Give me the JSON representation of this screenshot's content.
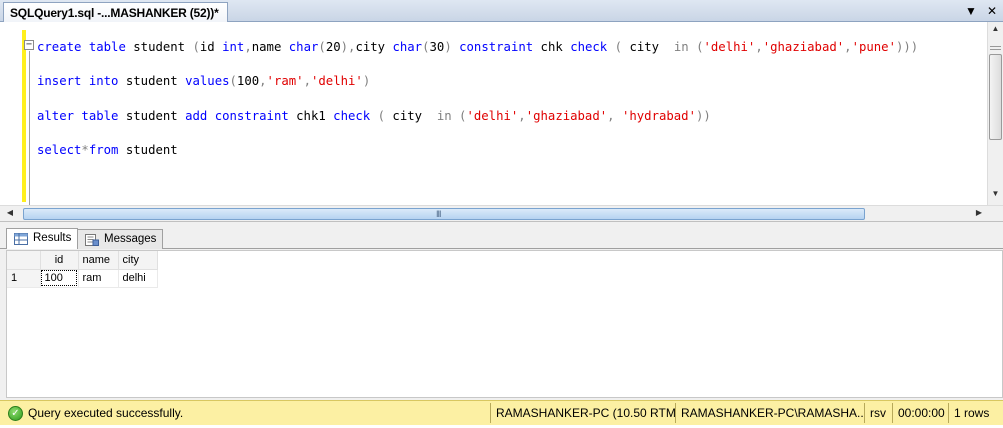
{
  "document_tab": {
    "title": "SQLQuery1.sql -...MASHANKER (52))*",
    "dropdown_glyph": "▼",
    "close_glyph": "✕"
  },
  "editor": {
    "collapse_glyph": "−",
    "lines": {
      "l1": {
        "t1": "create",
        "t2": "table",
        "t3": " student ",
        "t4": "(",
        "t5": "id ",
        "t6": "int",
        "t7": ",",
        "t8": "name ",
        "t9": "char",
        "t10": "(",
        "t11": "20",
        "t12": "),",
        "t13": "city ",
        "t14": "char",
        "t15": "(",
        "t16": "30",
        "t17": ")",
        "t18": " constraint",
        "t19": " chk ",
        "t20": "check",
        "t21": " ( ",
        "t22": "city  ",
        "t23": "in",
        "t24": " (",
        "t25": "'delhi'",
        "t26": ",",
        "t27": "'ghaziabad'",
        "t28": ",",
        "t29": "'pune'",
        "t30": ")))"
      },
      "l2": {
        "t1": "insert",
        "t2": " into",
        "t3": " student ",
        "t4": "values",
        "t5": "(",
        "t6": "100",
        "t7": ",",
        "t8": "'ram'",
        "t9": ",",
        "t10": "'delhi'",
        "t11": ")"
      },
      "l3": {
        "t1": "alter",
        "t2": " table",
        "t3": " student ",
        "t4": "add",
        "t5": " constraint",
        "t6": " chk1 ",
        "t7": "check",
        "t8": " ( ",
        "t9": "city  ",
        "t10": "in",
        "t11": " (",
        "t12": "'delhi'",
        "t13": ",",
        "t14": "'ghaziabad'",
        "t15": ", ",
        "t16": "'hydrabad'",
        "t17": "))"
      },
      "l4": {
        "t1": "select",
        "t2": "*",
        "t3": "from",
        "t4": " student"
      }
    }
  },
  "scrollbars": {
    "up": "▲",
    "down": "▼",
    "left": "◀",
    "right": "▶",
    "grip": "III"
  },
  "results": {
    "tabs": {
      "results": "Results",
      "messages": "Messages"
    },
    "columns": [
      "id",
      "name",
      "city"
    ],
    "rows": [
      {
        "num": "1",
        "id": "100",
        "name": "ram",
        "city": "delhi"
      }
    ]
  },
  "status": {
    "check_glyph": "✓",
    "message": "Query executed successfully.",
    "server": "RAMASHANKER-PC (10.50 RTM)",
    "login": "RAMASHANKER-PC\\RAMASHA...",
    "database": "rsv",
    "elapsed": "00:00:00",
    "row_count": "1 rows"
  },
  "colors": {
    "keyword": "#0000ff",
    "string": "#e00000",
    "operator": "#808080",
    "function": "#ff00ff",
    "status_bg": "#fcf0a3",
    "change_margin": "#ffef1c"
  }
}
